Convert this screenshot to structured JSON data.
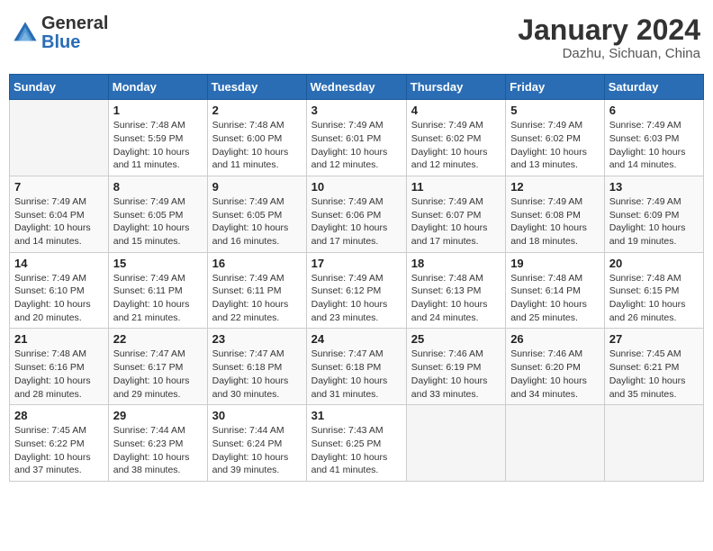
{
  "header": {
    "logo_general": "General",
    "logo_blue": "Blue",
    "month_year": "January 2024",
    "location": "Dazhu, Sichuan, China"
  },
  "days_of_week": [
    "Sunday",
    "Monday",
    "Tuesday",
    "Wednesday",
    "Thursday",
    "Friday",
    "Saturday"
  ],
  "weeks": [
    [
      {
        "day": "",
        "info": ""
      },
      {
        "day": "1",
        "info": "Sunrise: 7:48 AM\nSunset: 5:59 PM\nDaylight: 10 hours and 11 minutes."
      },
      {
        "day": "2",
        "info": "Sunrise: 7:48 AM\nSunset: 6:00 PM\nDaylight: 10 hours and 11 minutes."
      },
      {
        "day": "3",
        "info": "Sunrise: 7:49 AM\nSunset: 6:01 PM\nDaylight: 10 hours and 12 minutes."
      },
      {
        "day": "4",
        "info": "Sunrise: 7:49 AM\nSunset: 6:02 PM\nDaylight: 10 hours and 12 minutes."
      },
      {
        "day": "5",
        "info": "Sunrise: 7:49 AM\nSunset: 6:02 PM\nDaylight: 10 hours and 13 minutes."
      },
      {
        "day": "6",
        "info": "Sunrise: 7:49 AM\nSunset: 6:03 PM\nDaylight: 10 hours and 14 minutes."
      }
    ],
    [
      {
        "day": "7",
        "info": "Sunrise: 7:49 AM\nSunset: 6:04 PM\nDaylight: 10 hours and 14 minutes."
      },
      {
        "day": "8",
        "info": "Sunrise: 7:49 AM\nSunset: 6:05 PM\nDaylight: 10 hours and 15 minutes."
      },
      {
        "day": "9",
        "info": "Sunrise: 7:49 AM\nSunset: 6:05 PM\nDaylight: 10 hours and 16 minutes."
      },
      {
        "day": "10",
        "info": "Sunrise: 7:49 AM\nSunset: 6:06 PM\nDaylight: 10 hours and 17 minutes."
      },
      {
        "day": "11",
        "info": "Sunrise: 7:49 AM\nSunset: 6:07 PM\nDaylight: 10 hours and 17 minutes."
      },
      {
        "day": "12",
        "info": "Sunrise: 7:49 AM\nSunset: 6:08 PM\nDaylight: 10 hours and 18 minutes."
      },
      {
        "day": "13",
        "info": "Sunrise: 7:49 AM\nSunset: 6:09 PM\nDaylight: 10 hours and 19 minutes."
      }
    ],
    [
      {
        "day": "14",
        "info": "Sunrise: 7:49 AM\nSunset: 6:10 PM\nDaylight: 10 hours and 20 minutes."
      },
      {
        "day": "15",
        "info": "Sunrise: 7:49 AM\nSunset: 6:11 PM\nDaylight: 10 hours and 21 minutes."
      },
      {
        "day": "16",
        "info": "Sunrise: 7:49 AM\nSunset: 6:11 PM\nDaylight: 10 hours and 22 minutes."
      },
      {
        "day": "17",
        "info": "Sunrise: 7:49 AM\nSunset: 6:12 PM\nDaylight: 10 hours and 23 minutes."
      },
      {
        "day": "18",
        "info": "Sunrise: 7:48 AM\nSunset: 6:13 PM\nDaylight: 10 hours and 24 minutes."
      },
      {
        "day": "19",
        "info": "Sunrise: 7:48 AM\nSunset: 6:14 PM\nDaylight: 10 hours and 25 minutes."
      },
      {
        "day": "20",
        "info": "Sunrise: 7:48 AM\nSunset: 6:15 PM\nDaylight: 10 hours and 26 minutes."
      }
    ],
    [
      {
        "day": "21",
        "info": "Sunrise: 7:48 AM\nSunset: 6:16 PM\nDaylight: 10 hours and 28 minutes."
      },
      {
        "day": "22",
        "info": "Sunrise: 7:47 AM\nSunset: 6:17 PM\nDaylight: 10 hours and 29 minutes."
      },
      {
        "day": "23",
        "info": "Sunrise: 7:47 AM\nSunset: 6:18 PM\nDaylight: 10 hours and 30 minutes."
      },
      {
        "day": "24",
        "info": "Sunrise: 7:47 AM\nSunset: 6:18 PM\nDaylight: 10 hours and 31 minutes."
      },
      {
        "day": "25",
        "info": "Sunrise: 7:46 AM\nSunset: 6:19 PM\nDaylight: 10 hours and 33 minutes."
      },
      {
        "day": "26",
        "info": "Sunrise: 7:46 AM\nSunset: 6:20 PM\nDaylight: 10 hours and 34 minutes."
      },
      {
        "day": "27",
        "info": "Sunrise: 7:45 AM\nSunset: 6:21 PM\nDaylight: 10 hours and 35 minutes."
      }
    ],
    [
      {
        "day": "28",
        "info": "Sunrise: 7:45 AM\nSunset: 6:22 PM\nDaylight: 10 hours and 37 minutes."
      },
      {
        "day": "29",
        "info": "Sunrise: 7:44 AM\nSunset: 6:23 PM\nDaylight: 10 hours and 38 minutes."
      },
      {
        "day": "30",
        "info": "Sunrise: 7:44 AM\nSunset: 6:24 PM\nDaylight: 10 hours and 39 minutes."
      },
      {
        "day": "31",
        "info": "Sunrise: 7:43 AM\nSunset: 6:25 PM\nDaylight: 10 hours and 41 minutes."
      },
      {
        "day": "",
        "info": ""
      },
      {
        "day": "",
        "info": ""
      },
      {
        "day": "",
        "info": ""
      }
    ]
  ]
}
